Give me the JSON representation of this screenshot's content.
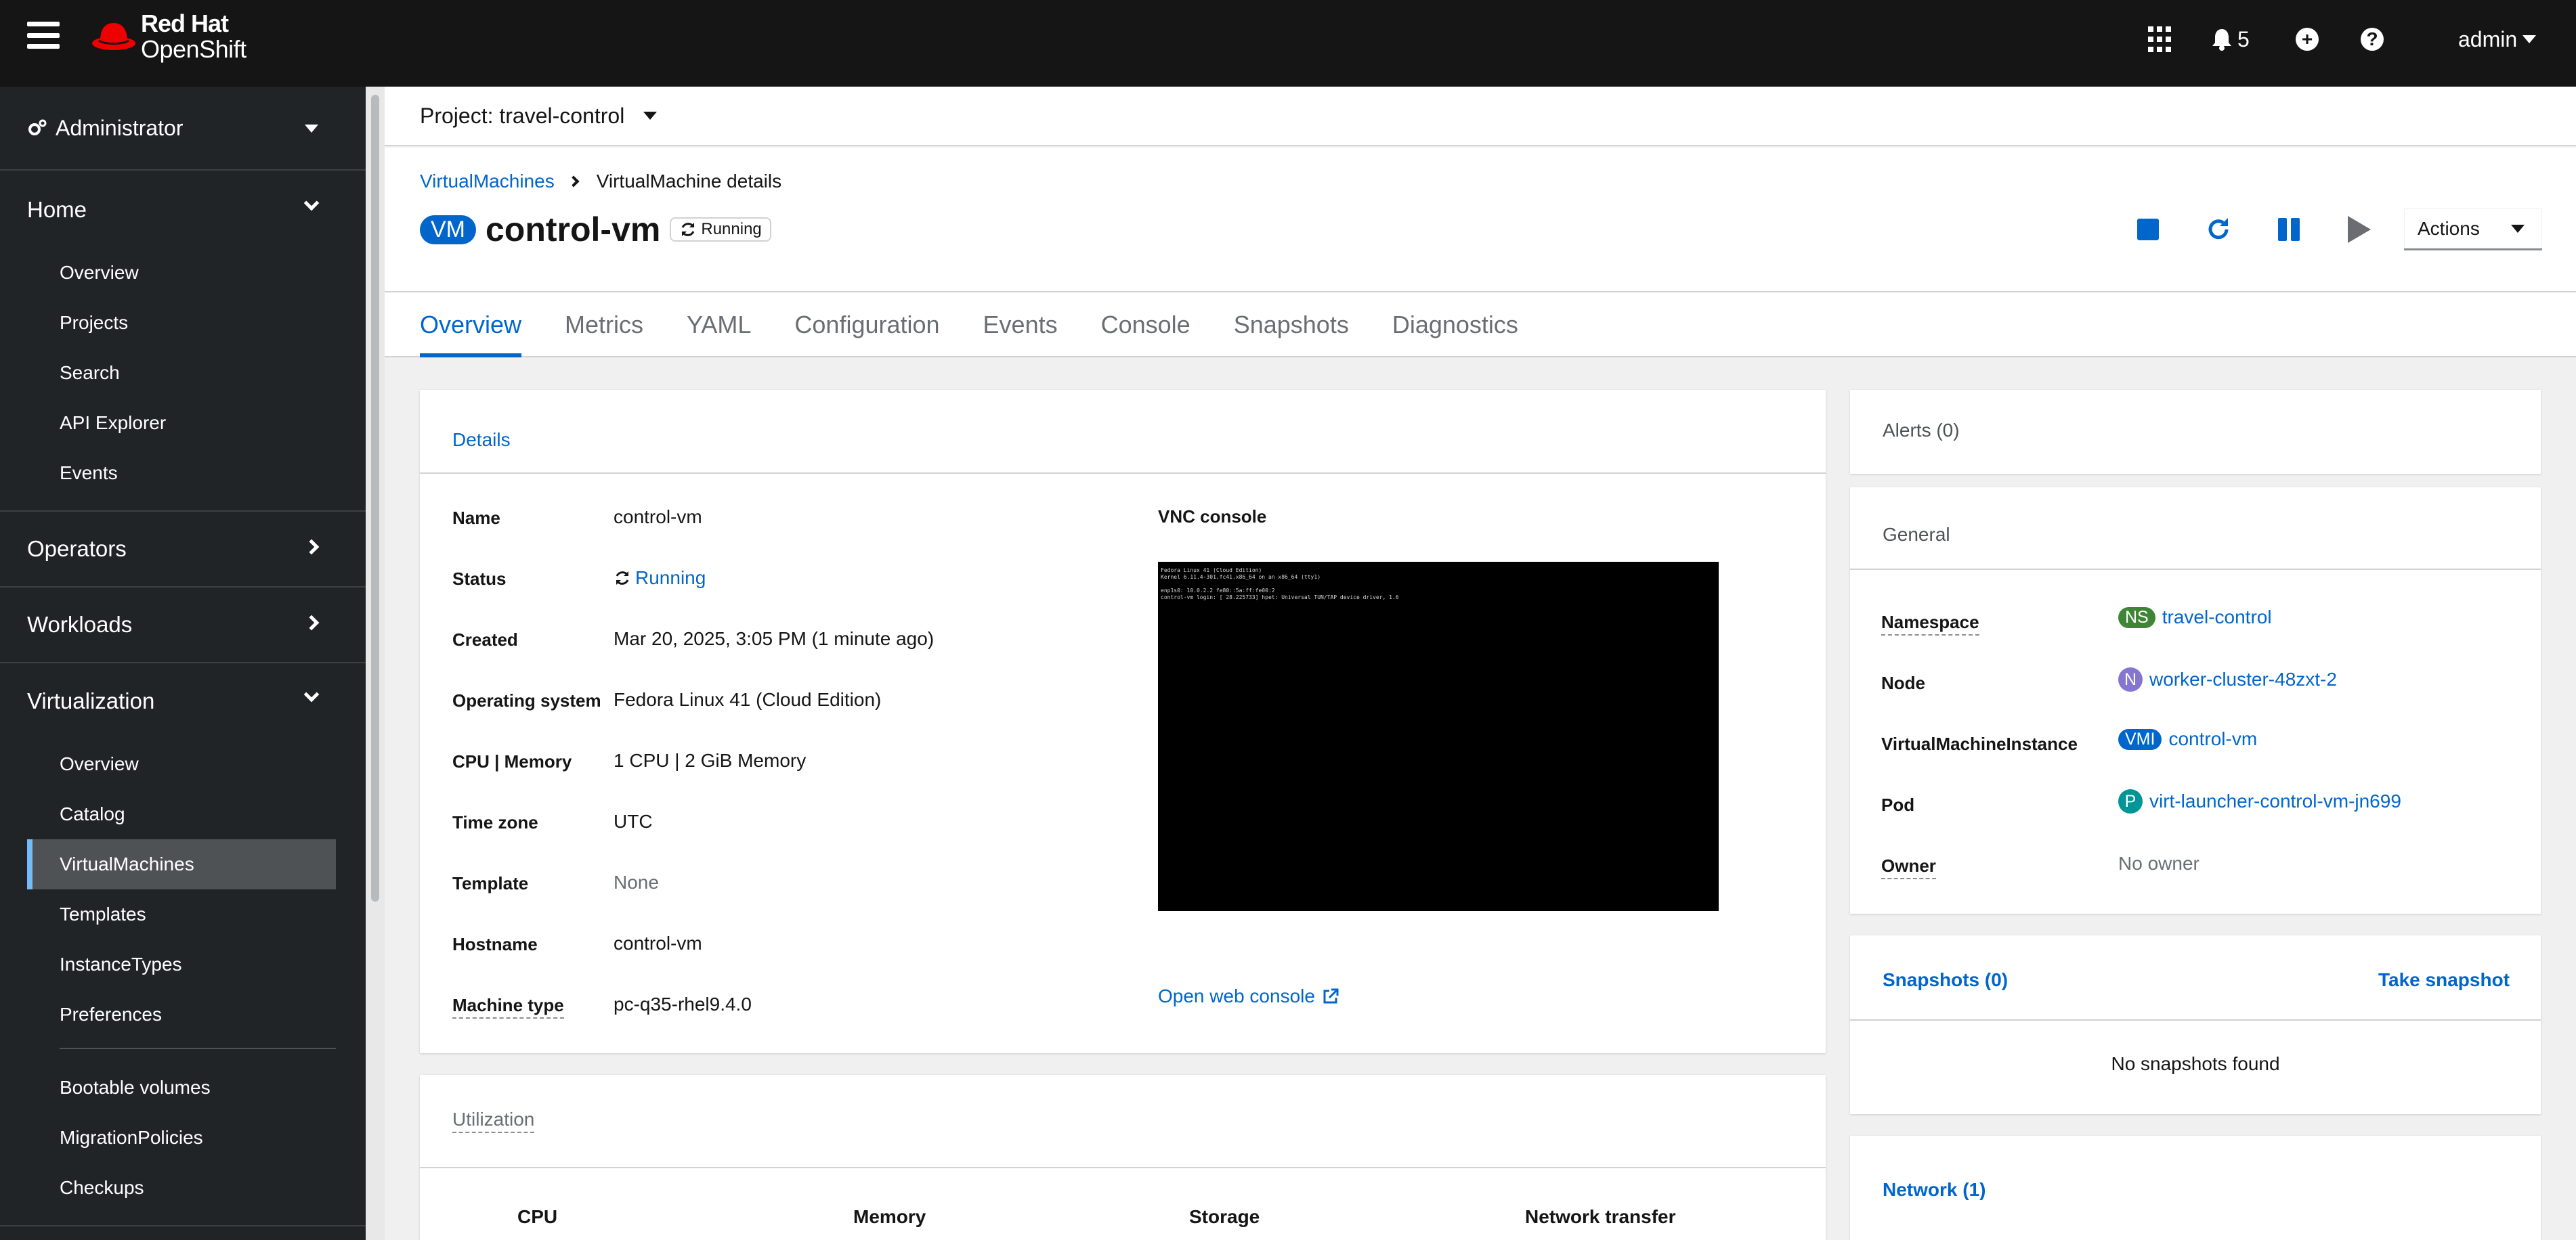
{
  "masthead": {
    "brand_line1": "Red Hat",
    "brand_line2": "OpenShift",
    "notification_count": "5",
    "user": "admin",
    "icons": [
      "menu-icon",
      "apps-grid-icon",
      "bell-icon",
      "plus-circle-icon",
      "help-icon"
    ]
  },
  "sidebar": {
    "perspective": "Administrator",
    "sections": {
      "home": {
        "label": "Home",
        "items": [
          "Overview",
          "Projects",
          "Search",
          "API Explorer",
          "Events"
        ]
      },
      "operators": {
        "label": "Operators"
      },
      "workloads": {
        "label": "Workloads"
      },
      "virtualization": {
        "label": "Virtualization",
        "items": [
          "Overview",
          "Catalog",
          "VirtualMachines",
          "Templates",
          "InstanceTypes",
          "Preferences",
          "Bootable volumes",
          "MigrationPolicies",
          "Checkups"
        ],
        "active": "VirtualMachines"
      }
    }
  },
  "project": {
    "label": "Project: travel-control"
  },
  "breadcrumb": {
    "parent": "VirtualMachines",
    "current": "VirtualMachine details"
  },
  "vm": {
    "badge": "VM",
    "name": "control-vm",
    "status": "Running"
  },
  "actions": {
    "label": "Actions"
  },
  "tabs": [
    "Overview",
    "Metrics",
    "YAML",
    "Configuration",
    "Events",
    "Console",
    "Snapshots",
    "Diagnostics"
  ],
  "details": {
    "title": "Details",
    "fields": {
      "name": {
        "label": "Name",
        "value": "control-vm"
      },
      "status": {
        "label": "Status",
        "value": "Running"
      },
      "created": {
        "label": "Created",
        "value": "Mar 20, 2025, 3:05 PM (1 minute ago)"
      },
      "os": {
        "label": "Operating system",
        "value": "Fedora Linux 41 (Cloud Edition)"
      },
      "cpu_memory": {
        "label": "CPU | Memory",
        "value": "1 CPU | 2 GiB Memory"
      },
      "timezone": {
        "label": "Time zone",
        "value": "UTC"
      },
      "template": {
        "label": "Template",
        "value": "None"
      },
      "hostname": {
        "label": "Hostname",
        "value": "control-vm"
      },
      "machine_type": {
        "label": "Machine type",
        "value": "pc-q35-rhel9.4.0"
      }
    },
    "vnc_title": "VNC console",
    "vnc_lines": [
      "Fedora Linux 41 (Cloud Edition)",
      "Kernel 6.11.4-301.fc41.x86_64 on an x86_64 (tty1)",
      "",
      "enp1s0: 10.0.2.2 fe80::5a:ff:fe00:2",
      "control-vm login: [   28.225733] hpet: Universal TUN/TAP device driver, 1.6"
    ],
    "open_web_console": "Open web console"
  },
  "utilization": {
    "title": "Utilization",
    "columns": [
      "CPU",
      "Memory",
      "Storage",
      "Network transfer"
    ]
  },
  "alerts": {
    "title": "Alerts (0)"
  },
  "general": {
    "title": "General",
    "namespace": {
      "label": "Namespace",
      "badge": "NS",
      "value": "travel-control",
      "color": "#3e8635"
    },
    "node": {
      "label": "Node",
      "badge": "N",
      "value": "worker-cluster-48zxt-2",
      "color": "#8476d1"
    },
    "vmi": {
      "label": "VirtualMachineInstance",
      "badge": "VMI",
      "value": "control-vm",
      "color": "#0066cc"
    },
    "pod": {
      "label": "Pod",
      "badge": "P",
      "value": "virt-launcher-control-vm-jn699",
      "color": "#009596"
    },
    "owner": {
      "label": "Owner",
      "value": "No owner"
    }
  },
  "snapshots": {
    "title": "Snapshots (0)",
    "action": "Take snapshot",
    "empty": "No snapshots found"
  },
  "network": {
    "title": "Network (1)"
  },
  "colors": {
    "accent": "#0066cc",
    "masthead": "#151515",
    "sidebar": "#212427"
  }
}
